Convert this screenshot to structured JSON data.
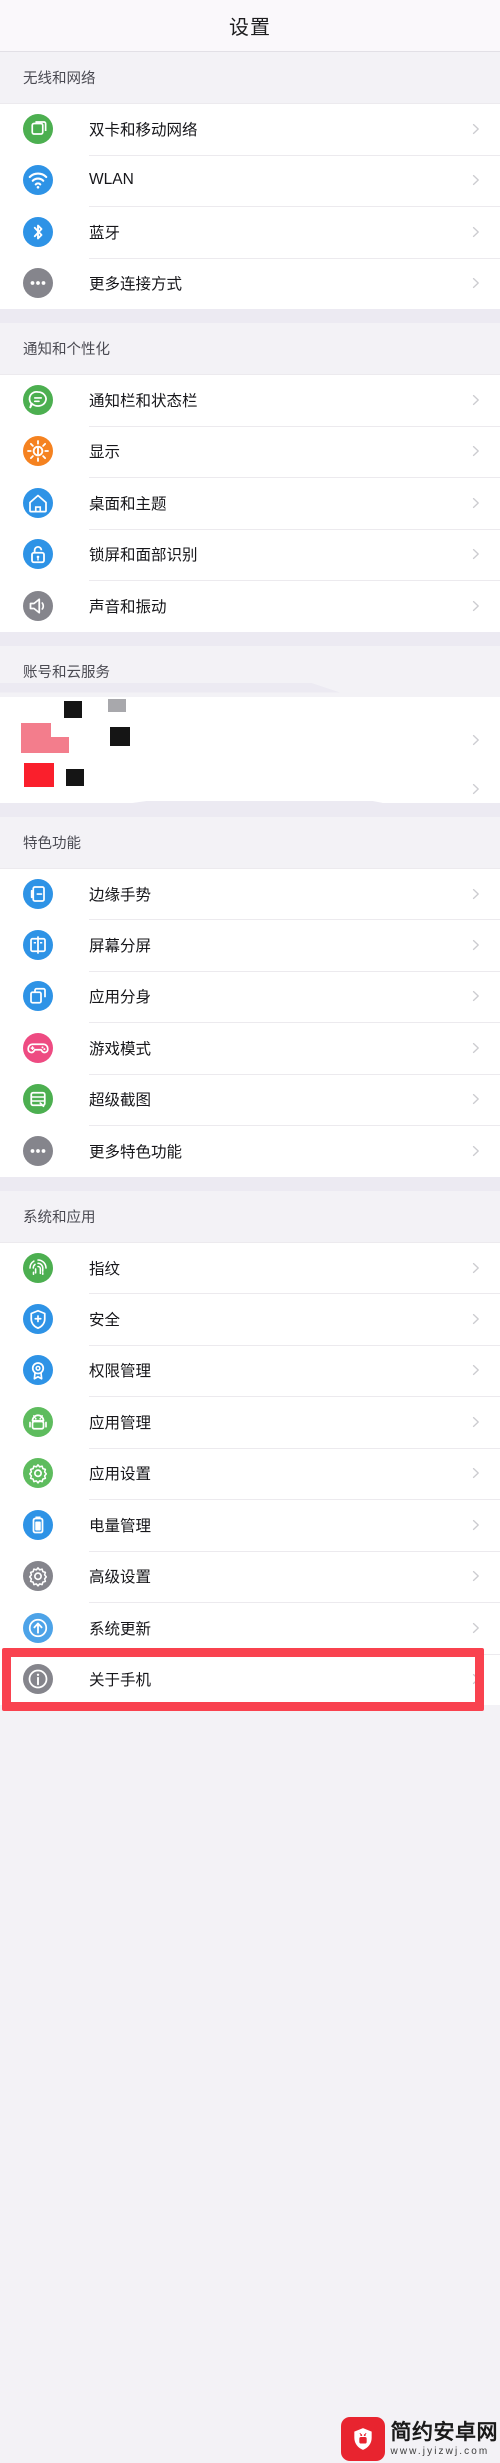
{
  "header": {
    "title": "设置"
  },
  "sections": [
    {
      "id": "wireless",
      "title": "无线和网络",
      "items": [
        {
          "label": "双卡和移动网络",
          "icon": "sim-card-icon",
          "color": "#4caf50"
        },
        {
          "label": "WLAN",
          "icon": "wifi-icon",
          "color": "#2e93e6"
        },
        {
          "label": "蓝牙",
          "icon": "bluetooth-icon",
          "color": "#2e93e6"
        },
        {
          "label": "更多连接方式",
          "icon": "more-dots-icon",
          "color": "#85858c"
        }
      ]
    },
    {
      "id": "notification",
      "title": "通知和个性化",
      "items": [
        {
          "label": "通知栏和状态栏",
          "icon": "chat-bubble-icon",
          "color": "#4caf50"
        },
        {
          "label": "显示",
          "icon": "brightness-icon",
          "color": "#f58220"
        },
        {
          "label": "桌面和主题",
          "icon": "home-icon",
          "color": "#2e93e6"
        },
        {
          "label": "锁屏和面部识别",
          "icon": "lock-icon",
          "color": "#2e93e6"
        },
        {
          "label": "声音和振动",
          "icon": "speaker-icon",
          "color": "#85858c"
        }
      ]
    },
    {
      "id": "account",
      "title": "账号和云服务",
      "corrupted": true,
      "items": [
        {
          "label": "",
          "icon": "corrupted-icon",
          "color": "#f04b56"
        },
        {
          "label": "",
          "icon": "corrupted-icon",
          "color": "#fa1f2c"
        }
      ]
    },
    {
      "id": "features",
      "title": "特色功能",
      "items": [
        {
          "label": "边缘手势",
          "icon": "edge-gesture-icon",
          "color": "#2e93e6"
        },
        {
          "label": "屏幕分屏",
          "icon": "split-screen-icon",
          "color": "#2e93e6"
        },
        {
          "label": "应用分身",
          "icon": "app-clone-icon",
          "color": "#2e93e6"
        },
        {
          "label": "游戏模式",
          "icon": "gamepad-icon",
          "color": "#ee4b82"
        },
        {
          "label": "超级截图",
          "icon": "screenshot-icon",
          "color": "#4caf50"
        },
        {
          "label": "更多特色功能",
          "icon": "more-dots-icon",
          "color": "#85858c"
        }
      ]
    },
    {
      "id": "system",
      "title": "系统和应用",
      "items": [
        {
          "label": "指纹",
          "icon": "fingerprint-icon",
          "color": "#4caf50"
        },
        {
          "label": "安全",
          "icon": "shield-icon",
          "color": "#2e93e6"
        },
        {
          "label": "权限管理",
          "icon": "badge-icon",
          "color": "#2e93e6"
        },
        {
          "label": "应用管理",
          "icon": "android-icon",
          "color": "#5ebc5e"
        },
        {
          "label": "应用设置",
          "icon": "gear-green-icon",
          "color": "#5ebc5e"
        },
        {
          "label": "电量管理",
          "icon": "battery-icon",
          "color": "#2e93e6"
        },
        {
          "label": "高级设置",
          "icon": "gear-gray-icon",
          "color": "#85858c"
        },
        {
          "label": "系统更新",
          "icon": "upload-arrow-icon",
          "color": "#4da3e8"
        },
        {
          "label": "关于手机",
          "icon": "info-icon",
          "color": "#85858c",
          "highlighted": true
        }
      ]
    }
  ],
  "watermark": {
    "name": "简约安卓网",
    "url": "www.jyizwj.com",
    "logo_icon": "android-shield-icon",
    "color": "#e8242f"
  },
  "highlight": {
    "color": "#f9424f"
  }
}
